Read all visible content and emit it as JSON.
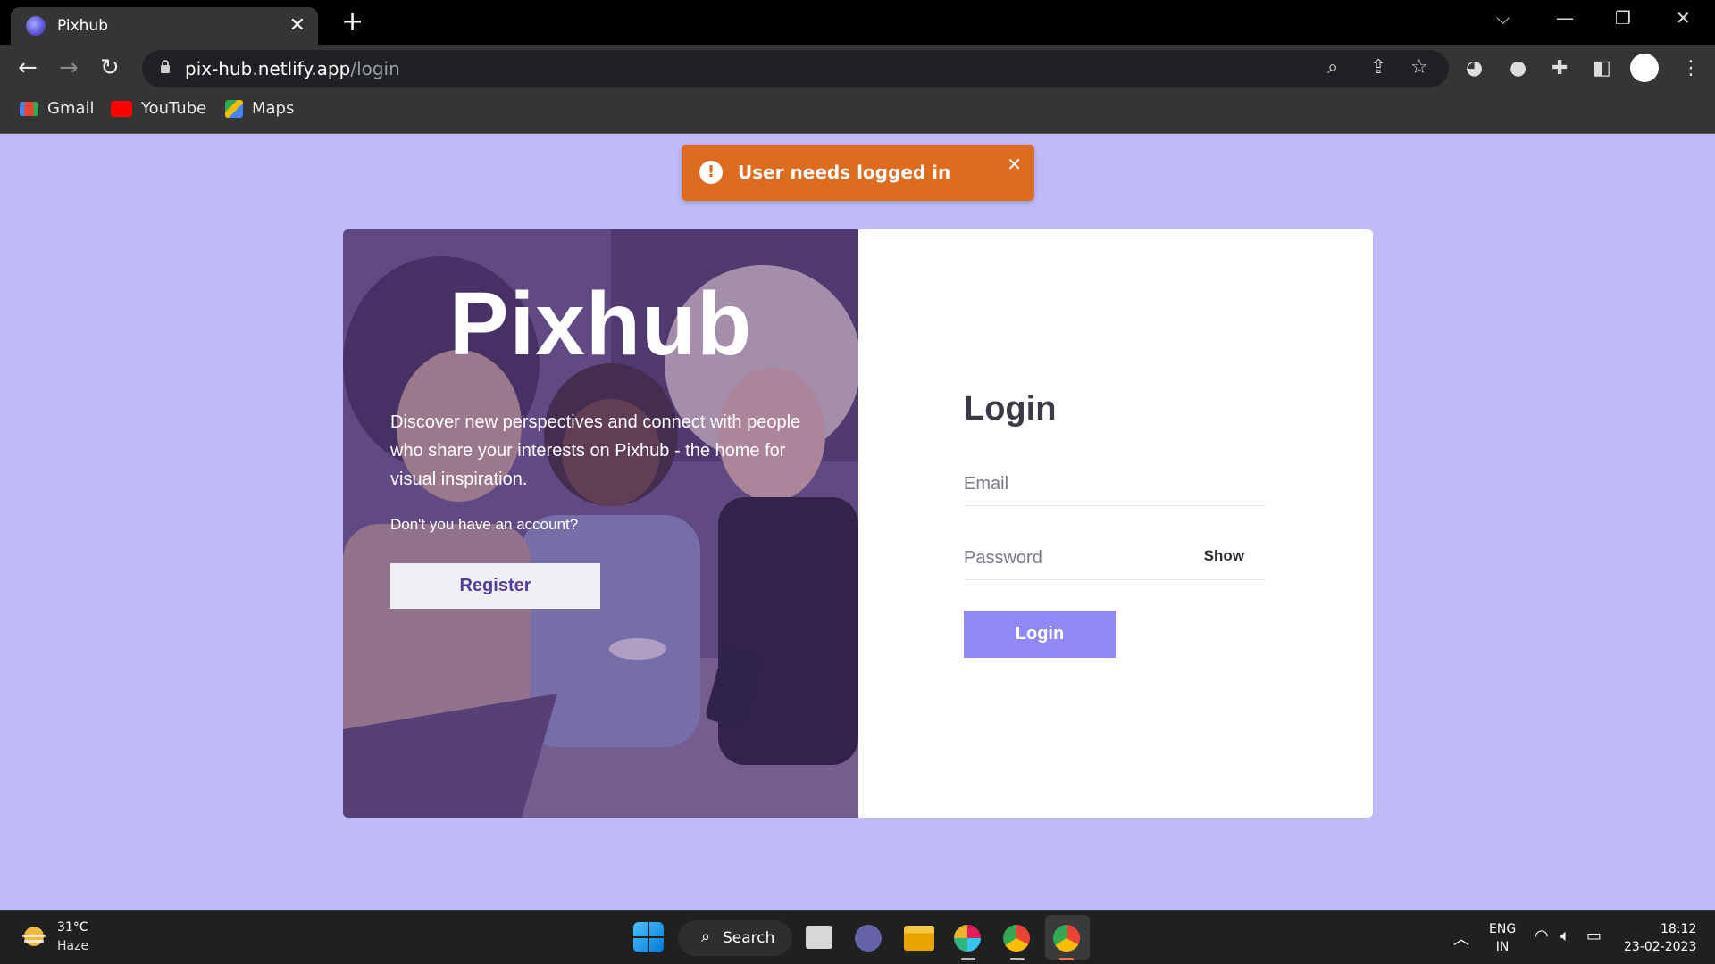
{
  "browser": {
    "tab_title": "Pixhub",
    "url_host": "pix-hub.netlify.app",
    "url_path": "/login",
    "bookmarks": [
      {
        "label": "Gmail",
        "icon": "gmail-icon"
      },
      {
        "label": "YouTube",
        "icon": "youtube-icon"
      },
      {
        "label": "Maps",
        "icon": "maps-icon"
      }
    ]
  },
  "toast": {
    "message": "User needs logged in",
    "color": "#dd6b20"
  },
  "hero": {
    "brand": "Pixhub",
    "tagline": "Discover new perspectives and connect with people who share your interests on Pixhub - the home for visual inspiration.",
    "no_account": "Don't you have an account?",
    "register_label": "Register"
  },
  "login": {
    "heading": "Login",
    "email_placeholder": "Email",
    "password_placeholder": "Password",
    "show_label": "Show",
    "submit_label": "Login",
    "accent": "#9088f3"
  },
  "taskbar": {
    "temperature": "31°C",
    "weather": "Haze",
    "search_label": "Search",
    "lang_line1": "ENG",
    "lang_line2": "IN",
    "time": "18:12",
    "date": "23-02-2023"
  },
  "colors": {
    "page_background": "#bfbbfb"
  }
}
